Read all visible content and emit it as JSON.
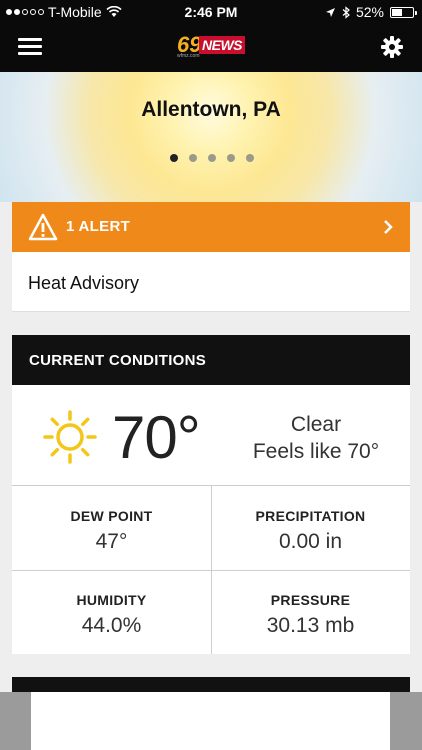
{
  "status_bar": {
    "carrier": "T-Mobile",
    "time": "2:46 PM",
    "battery": "52%",
    "battery_level": 0.52,
    "signal_bars": 2
  },
  "nav": {
    "logo_number": "69",
    "logo_word": "NEWS",
    "logo_sub": "wfmz.com",
    "menu_icon": "list-icon",
    "settings_icon": "gear-icon"
  },
  "hero": {
    "city": "Allentown, PA",
    "pages": 5,
    "active_page": 0
  },
  "alerts": {
    "label": "1 ALERT",
    "items": [
      {
        "text": "Heat Advisory"
      }
    ],
    "color": "#ef8a1a"
  },
  "current_conditions": {
    "header": "CURRENT CONDITIONS",
    "icon": "sun-icon",
    "temperature": "70°",
    "description": "Clear",
    "feels_like": "Feels like 70°",
    "details": [
      {
        "label": "DEW POINT",
        "value": "47°"
      },
      {
        "label": "PRECIPITATION",
        "value": "0.00 in"
      },
      {
        "label": "HUMIDITY",
        "value": "44.0%"
      },
      {
        "label": "PRESSURE",
        "value": "30.13 mb"
      }
    ]
  }
}
